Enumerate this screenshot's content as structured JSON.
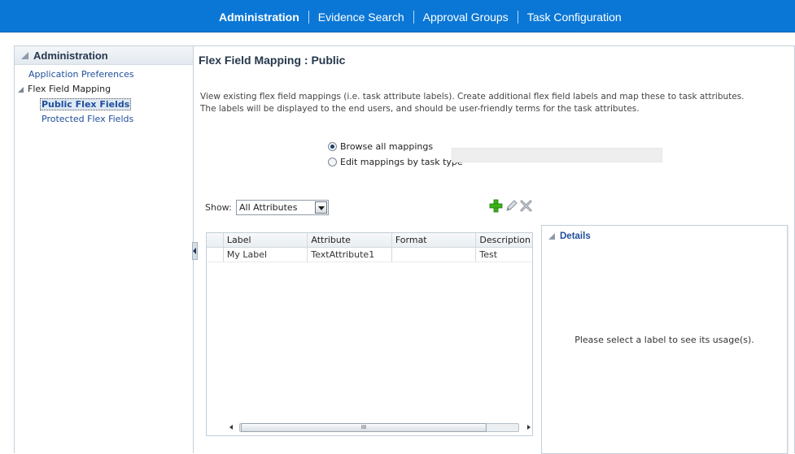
{
  "topnav": {
    "items": [
      {
        "label": "Administration",
        "active": true
      },
      {
        "label": "Evidence Search",
        "active": false
      },
      {
        "label": "Approval Groups",
        "active": false
      },
      {
        "label": "Task Configuration",
        "active": false
      }
    ]
  },
  "sidebar": {
    "title": "Administration",
    "items": {
      "app_prefs": "Application Preferences",
      "flex_mapping": "Flex Field Mapping",
      "public_flex": "Public Flex Fields",
      "protected_flex": "Protected Flex Fields"
    }
  },
  "main": {
    "title": "Flex Field Mapping : Public",
    "description_line1": "View existing flex field mappings (i.e. task attribute labels). Create additional flex field labels and map these to task attributes.",
    "description_line2": "The labels will be displayed to the end users, and should be user-friendly terms for the task attributes.",
    "radio_browse": "Browse all mappings",
    "radio_edit": "Edit mappings by task type",
    "show_label": "Show:",
    "show_value": "All Attributes",
    "table": {
      "columns": [
        "Label",
        "Attribute",
        "Format",
        "Description"
      ],
      "rows": [
        [
          "My Label",
          "TextAttribute1",
          "",
          "Test"
        ]
      ],
      "scroll_grip": "III"
    },
    "details": {
      "title": "Details",
      "message": "Please select a label to see its usage(s)."
    }
  },
  "colors": {
    "topbar": "#0a77d6",
    "link": "#1f4e9a",
    "add_icon": "#3bb318"
  },
  "icons": [
    "add-icon",
    "edit-icon",
    "delete-icon",
    "collapse-icon",
    "disclosure-icon"
  ]
}
